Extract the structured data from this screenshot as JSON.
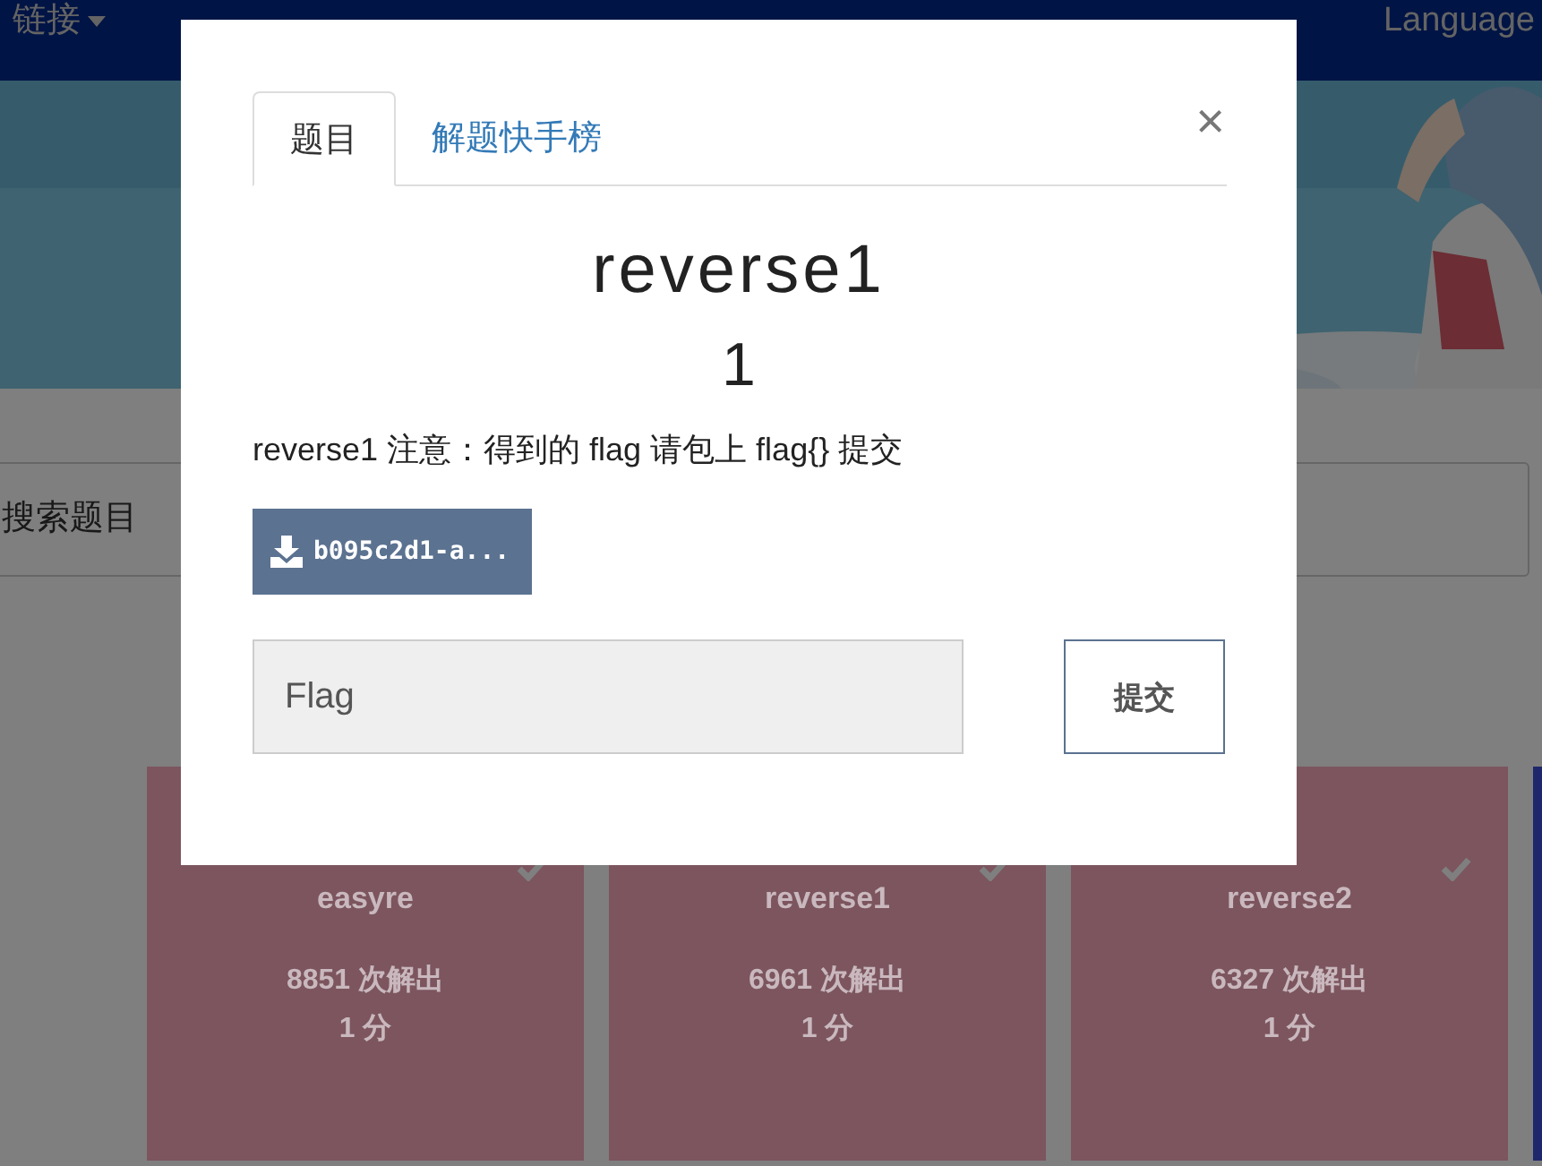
{
  "navbar": {
    "items": [
      {
        "label": "链接",
        "dropdown": true
      }
    ],
    "language": "Language"
  },
  "search": {
    "placeholder": "搜索题目"
  },
  "challenges": [
    {
      "name": "easyre",
      "solves": "8851 次解出",
      "points": "1 分",
      "solved": true
    },
    {
      "name": "reverse1",
      "solves": "6961 次解出",
      "points": "1 分",
      "solved": true
    },
    {
      "name": "reverse2",
      "solves": "6327 次解出",
      "points": "1 分",
      "solved": true
    },
    {
      "solved": false
    }
  ],
  "modal": {
    "tabs": [
      {
        "label": "题目",
        "selected": true
      },
      {
        "label": "解题快手榜",
        "selected": false
      }
    ],
    "close": "×",
    "title": "reverse1",
    "value": "1",
    "description": "reverse1 注意：得到的 flag 请包上 flag{} 提交",
    "files": [
      "b095c2d1-a..."
    ],
    "flag_field": {
      "placeholder": "Flag"
    },
    "submit": "提交"
  }
}
